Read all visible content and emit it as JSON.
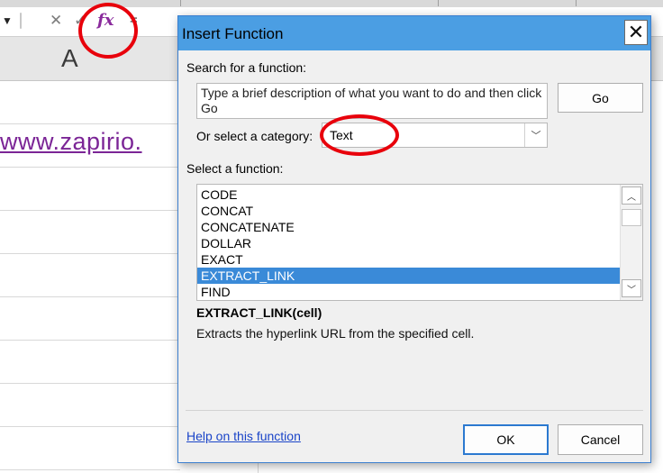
{
  "formula_bar": {
    "namebox_arrow_icon": "caret-down-icon",
    "cancel_icon": "x-icon",
    "confirm_icon": "checkmark-icon",
    "fx_label": "fx",
    "equals": "="
  },
  "sheet": {
    "column_a_label": "A",
    "cell_link_text": "www.zapirio.",
    "link_color": "#7b2596"
  },
  "dialog": {
    "title": "Insert Function",
    "close_icon": "close-x-icon",
    "search_label": "Search for a function:",
    "search_value": "Type a brief description of what you want to do and then click Go",
    "go_button": "Go",
    "category_label": "Or select a category:",
    "category_value": "Text",
    "function_label": "Select a function:",
    "functions": [
      "CODE",
      "CONCAT",
      "CONCATENATE",
      "DOLLAR",
      "EXACT",
      "EXTRACT_LINK",
      "FIND"
    ],
    "selected_function": "EXTRACT_LINK",
    "signature": "EXTRACT_LINK(cell)",
    "description": "Extracts the hyperlink URL from the specified cell.",
    "help_link": "Help on this function",
    "ok_button": "OK",
    "cancel_button": "Cancel",
    "accent_color": "#4b9ee3",
    "selection_color": "#3a8ad8"
  },
  "annotations": {
    "highlight_color": "#e8000b"
  }
}
